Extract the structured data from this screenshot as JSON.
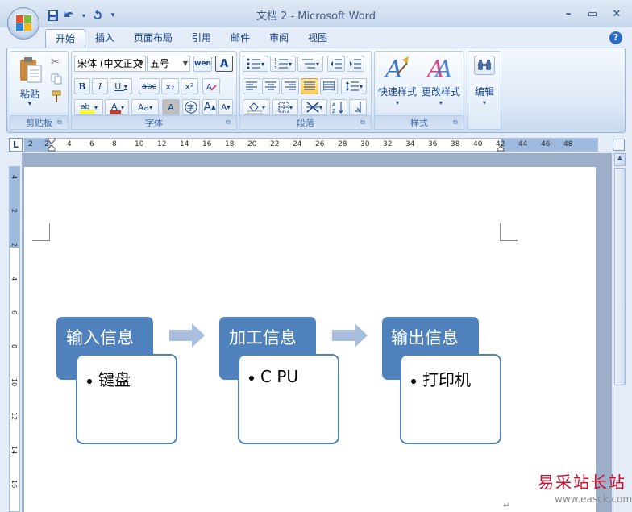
{
  "window": {
    "title": "文档 2 - Microsoft Word",
    "controls": {
      "minimize": "–",
      "maximize": "▭",
      "close": "✕"
    }
  },
  "quick_access": {
    "save_icon": "save-icon",
    "undo_icon": "undo-icon",
    "redo_icon": "redo-icon",
    "customize": "▾"
  },
  "tabs": [
    "开始",
    "插入",
    "页面布局",
    "引用",
    "邮件",
    "审阅",
    "视图"
  ],
  "help_label": "?",
  "ribbon": {
    "clipboard": {
      "label": "剪贴板",
      "paste": "粘贴"
    },
    "font": {
      "label": "字体",
      "font_name": "宋体 (中文正文",
      "font_size": "五号",
      "bold": "B",
      "italic": "I",
      "underline": "U",
      "strike": "abc",
      "subscript": "x₂",
      "superscript": "x²",
      "grow": "A",
      "shrink": "A",
      "case": "Aa",
      "phonetic": "wén",
      "clear": "A"
    },
    "paragraph": {
      "label": "段落"
    },
    "styles": {
      "label": "样式",
      "quick_styles": "快速样式",
      "change_styles": "更改样式"
    },
    "editing": {
      "label": "编辑",
      "edit": "编辑"
    }
  },
  "ruler": {
    "h_ticks": [
      "2",
      "2",
      "4",
      "6",
      "8",
      "10",
      "12",
      "14",
      "16",
      "18",
      "20",
      "22",
      "24",
      "26",
      "28",
      "30",
      "32",
      "34",
      "36",
      "38",
      "40",
      "42",
      "44",
      "46",
      "48"
    ],
    "v_ticks": [
      "4",
      "2",
      "2",
      "4",
      "6",
      "8",
      "10",
      "12",
      "14",
      "16",
      "18"
    ],
    "corner_label": "L"
  },
  "smartart": {
    "steps": [
      {
        "title": "输入信息",
        "item": "键盘"
      },
      {
        "title": "加工信息",
        "item": "C PU"
      },
      {
        "title": "输出信息",
        "item": "打印机"
      }
    ],
    "accent": "#4f81bd",
    "arrow_color": "#a9bedc"
  },
  "paragraph_mark": "↵",
  "watermark": {
    "brand": "易采站长站",
    "url": "www.easck.com"
  }
}
